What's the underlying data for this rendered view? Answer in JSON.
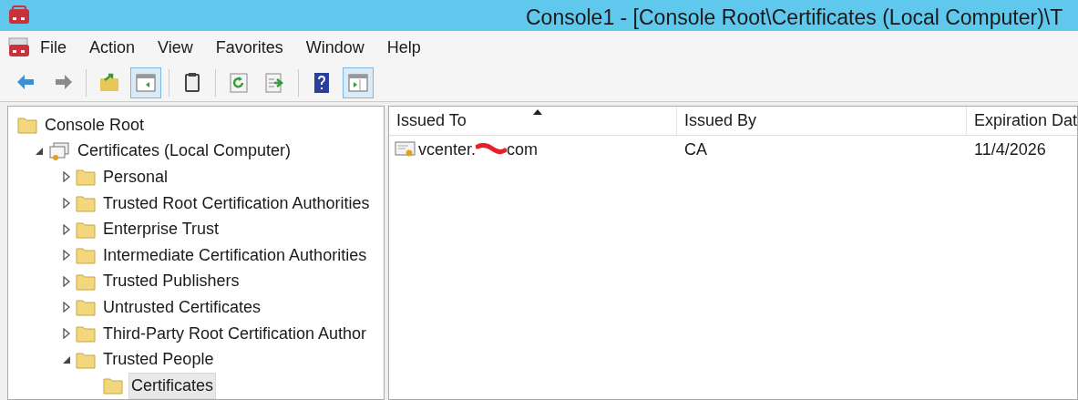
{
  "window": {
    "title": "Console1 - [Console Root\\Certificates (Local Computer)\\T"
  },
  "menu": [
    "File",
    "Action",
    "View",
    "Favorites",
    "Window",
    "Help"
  ],
  "toolbar": [
    {
      "kind": "back",
      "pressed": false
    },
    {
      "kind": "forward",
      "pressed": false
    },
    {
      "kind": "sep"
    },
    {
      "kind": "up",
      "pressed": false
    },
    {
      "kind": "tree",
      "pressed": true
    },
    {
      "kind": "sep"
    },
    {
      "kind": "clipboard",
      "pressed": false
    },
    {
      "kind": "sep"
    },
    {
      "kind": "refresh",
      "pressed": false
    },
    {
      "kind": "export",
      "pressed": false
    },
    {
      "kind": "sep"
    },
    {
      "kind": "help",
      "pressed": false
    },
    {
      "kind": "pane",
      "pressed": true
    }
  ],
  "tree": [
    {
      "label": "Console Root",
      "kind": "folder",
      "selected": false,
      "children": [
        {
          "label": "Certificates (Local Computer)",
          "kind": "store",
          "expanded": true,
          "selected": false,
          "children": [
            {
              "label": "Personal",
              "kind": "folder",
              "expanded": false,
              "selected": false
            },
            {
              "label": "Trusted Root Certification Authorities",
              "kind": "folder",
              "expanded": false,
              "selected": false
            },
            {
              "label": "Enterprise Trust",
              "kind": "folder",
              "expanded": false,
              "selected": false
            },
            {
              "label": "Intermediate Certification Authorities",
              "kind": "folder",
              "expanded": false,
              "selected": false
            },
            {
              "label": "Trusted Publishers",
              "kind": "folder",
              "expanded": false,
              "selected": false
            },
            {
              "label": "Untrusted Certificates",
              "kind": "folder",
              "expanded": false,
              "selected": false
            },
            {
              "label": "Third-Party Root Certification Author",
              "kind": "folder",
              "expanded": false,
              "selected": false
            },
            {
              "label": "Trusted People",
              "kind": "folder",
              "expanded": true,
              "selected": false,
              "children": [
                {
                  "label": "Certificates",
                  "kind": "folder",
                  "selected": true
                }
              ]
            }
          ]
        }
      ]
    }
  ],
  "table": {
    "columns": [
      {
        "label": "Issued To",
        "sorted": true
      },
      {
        "label": "Issued By",
        "sorted": false
      },
      {
        "label": "Expiration Dat",
        "sorted": false
      }
    ],
    "rows": [
      {
        "issued_to_start": "vcenter.",
        "redacted": true,
        "issued_to_end": "com",
        "issued_by": "CA",
        "expiration": "11/4/2026"
      }
    ]
  }
}
